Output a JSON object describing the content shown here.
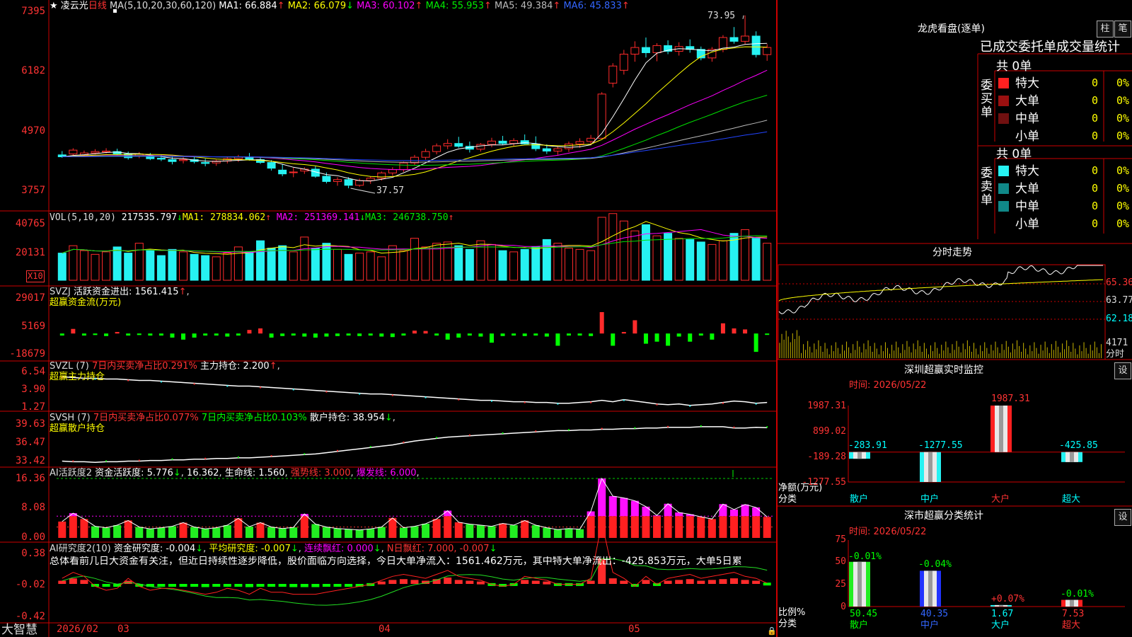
{
  "app": {
    "brand": "大智慧",
    "star": "★",
    "stock_name": "凌云光",
    "period": "日线"
  },
  "colors": {
    "up": "#ff2b2b",
    "down": "#26f2f2",
    "vol_green": "#00ff00",
    "axis": "#cc0000",
    "ma1": "#ffffff",
    "ma2": "#ffff00",
    "ma3": "#ff00ff",
    "ma4": "#00e000",
    "ma5": "#bbbbbb",
    "ma6": "#2244ff"
  },
  "price_panel": {
    "header": {
      "ma_title": "MA(5,10,20,30,60,120)",
      "items": [
        {
          "label": "MA1: 66.884",
          "arrow": "↑"
        },
        {
          "label": "MA2: 66.079",
          "arrow": "↓"
        },
        {
          "label": "MA3: 60.102",
          "arrow": "↑"
        },
        {
          "label": "MA4: 55.953",
          "arrow": "↑"
        },
        {
          "label": "MA5: 49.384",
          "arrow": "↑"
        },
        {
          "label": "MA6: 45.833",
          "arrow": "↑"
        }
      ]
    },
    "y_ticks": [
      "7395",
      "6182",
      "4970",
      "3757"
    ],
    "high_label": "73.95",
    "low_label": "37.57"
  },
  "vol_panel": {
    "title": "VOL(5,10,20)",
    "value": "217535.797",
    "value_arrow": "↓",
    "items": [
      {
        "label": "MA1: 278834.062",
        "arrow": "↑"
      },
      {
        "label": "MA2: 251369.141",
        "arrow": "↓"
      },
      {
        "label": "MA3: 246738.750",
        "arrow": "↑"
      }
    ],
    "y_ticks": [
      "40765",
      "20131"
    ],
    "unit": "X10"
  },
  "svzj_panel": {
    "title": "SVZJ",
    "label": "活跃资金进出: 1561.415",
    "arrow": "↑",
    "subtitle": "超赢资金流(万元)",
    "y_ticks": [
      "29017",
      "5169",
      "-18679"
    ]
  },
  "svzl_panel": {
    "title": "SVZL (7)",
    "net": "7日内买卖净占比0.291%",
    "hold": "主力持仓: 2.200",
    "hold_arrow": "↑",
    "subtitle": "超赢主力持仓",
    "y_ticks": [
      "6.54",
      "3.90",
      "1.27"
    ]
  },
  "svsh_panel": {
    "title": "SVSH (7)",
    "net1": "7日内买卖净占比0.077%",
    "net2": "7日内买卖净占比0.103%",
    "hold": "散户持仓: 38.954",
    "hold_arrow": "↓",
    "subtitle": "超赢散户持仓",
    "y_ticks": [
      "39.63",
      "36.47",
      "33.42"
    ]
  },
  "ai_active_panel": {
    "title": "AI活跃度2",
    "active": "资金活跃度: 5.776",
    "active_arrow": "↓",
    "value2": "16.362",
    "life": "生命线: 1.560",
    "strong": "强势线: 3.000",
    "burst": "爆发线: 6.000",
    "y_ticks": [
      "16.36",
      "8.08",
      "0.00"
    ]
  },
  "ai_research_panel": {
    "title": "AI研究度2(10)",
    "research": "资金研究度: -0.004",
    "research_arrow": "↓",
    "avg": "平均研究度: -0.007",
    "avg_arrow": "↓",
    "consec": "连续飘红: 0.000",
    "consec_arrow": "↓",
    "nday": "N日飘红: 7.000, -0.007",
    "nday_arrow": "↓",
    "summary": "总体看前几日大资金有关注，但近日持续性逐步降低，股价面临方向选择，今日大单净流入：1561.462万元，其中特大单净流出：-425.853万元，大单5日累",
    "y_ticks": [
      "0.38",
      "-0.02",
      "-0.42"
    ]
  },
  "x_axis": {
    "labels": [
      "2026/02",
      "03",
      "04",
      "05"
    ]
  },
  "dragon": {
    "title": "龙虎看盘(逐单)",
    "btn1": "柱",
    "btn2": "笔",
    "header": "已成交委托单成交量统计",
    "buy": {
      "side_label": "委买单",
      "total": "共 0单",
      "rows": [
        {
          "name": "特大",
          "value": "0",
          "pct": "0%"
        },
        {
          "name": "大单",
          "value": "0",
          "pct": "0%"
        },
        {
          "name": "中单",
          "value": "0",
          "pct": "0%"
        },
        {
          "name": "小单",
          "value": "0",
          "pct": "0%"
        }
      ]
    },
    "sell": {
      "side_label": "委卖单",
      "total": "共 0单",
      "rows": [
        {
          "name": "特大",
          "value": "0",
          "pct": "0%"
        },
        {
          "name": "大单",
          "value": "0",
          "pct": "0%"
        },
        {
          "name": "中单",
          "value": "0",
          "pct": "0%"
        },
        {
          "name": "小单",
          "value": "0",
          "pct": "0%"
        }
      ]
    }
  },
  "intraday": {
    "title": "分时走势",
    "y_ticks": [
      "65.36",
      "63.77",
      "62.18"
    ],
    "vol_label": "4171",
    "unit": "分时"
  },
  "sz_monitor": {
    "title": "深圳超赢实时监控",
    "time": "时间: 2026/05/22",
    "setting": "设",
    "y_ticks": [
      "1987.31",
      "899.02",
      "-189.28",
      "-1277.55"
    ],
    "y_unit": "净额(万元)",
    "x_title": "分类",
    "categories": [
      "散户",
      "中户",
      "大户",
      "超大"
    ],
    "value_labels": [
      "-283.91",
      "-1277.55",
      "1987.31",
      "-425.85"
    ]
  },
  "sz_class": {
    "title": "深市超赢分类统计",
    "time": "时间: 2026/05/22",
    "setting": "设",
    "y_ticks": [
      "75",
      "50",
      "25",
      "0"
    ],
    "y_unit": "比例%",
    "x_title": "分类",
    "categories": [
      "散户",
      "中户",
      "大户",
      "超大"
    ],
    "top_labels": [
      "-0.01%",
      "-0.04%",
      "+0.07%",
      "-0.01%"
    ],
    "bottom_labels": [
      "50.45",
      "40.35",
      "1.67",
      "7.53"
    ]
  },
  "chart_data": [
    {
      "type": "candlestick",
      "title": "凌云光 日线",
      "ylim": [
        34,
        76
      ],
      "annotations": [
        {
          "label": "73.95",
          "kind": "high"
        },
        {
          "label": "37.57",
          "kind": "low"
        }
      ],
      "ohlc": [
        [
          44.6,
          45.4,
          44.0,
          44.2
        ],
        [
          44.8,
          46.0,
          44.4,
          45.6
        ],
        [
          44.6,
          45.5,
          44.3,
          45.0
        ],
        [
          45.0,
          45.8,
          44.7,
          45.3
        ],
        [
          45.2,
          46.0,
          44.9,
          45.4
        ],
        [
          45.3,
          45.9,
          44.6,
          44.8
        ],
        [
          44.8,
          45.3,
          43.6,
          44.0
        ],
        [
          44.4,
          45.2,
          43.9,
          44.8
        ],
        [
          44.3,
          45.0,
          43.5,
          43.8
        ],
        [
          43.9,
          44.6,
          43.3,
          43.7
        ],
        [
          43.6,
          44.3,
          42.6,
          43.2
        ],
        [
          43.4,
          44.1,
          42.8,
          43.6
        ],
        [
          43.6,
          44.2,
          42.8,
          43.2
        ],
        [
          43.0,
          43.8,
          42.2,
          42.8
        ],
        [
          42.9,
          43.6,
          42.3,
          43.3
        ],
        [
          43.3,
          44.1,
          42.8,
          43.8
        ],
        [
          43.8,
          44.6,
          43.1,
          44.2
        ],
        [
          44.2,
          45.0,
          43.4,
          43.6
        ],
        [
          43.6,
          44.1,
          42.7,
          43.0
        ],
        [
          43.0,
          43.5,
          41.3,
          41.8
        ],
        [
          41.4,
          42.6,
          40.1,
          40.6
        ],
        [
          40.9,
          41.9,
          39.9,
          41.0
        ],
        [
          41.2,
          42.0,
          40.6,
          41.6
        ],
        [
          41.6,
          42.2,
          39.8,
          40.1
        ],
        [
          40.1,
          40.9,
          38.6,
          39.0
        ],
        [
          39.0,
          39.9,
          38.1,
          39.4
        ],
        [
          39.4,
          39.9,
          37.57,
          38.2
        ],
        [
          38.2,
          39.6,
          37.9,
          39.2
        ],
        [
          39.2,
          40.1,
          38.5,
          39.7
        ],
        [
          39.7,
          41.1,
          39.2,
          40.8
        ],
        [
          40.8,
          42.0,
          40.2,
          41.5
        ],
        [
          41.5,
          43.2,
          41.0,
          42.9
        ],
        [
          42.9,
          44.6,
          42.4,
          44.1
        ],
        [
          44.1,
          45.9,
          43.6,
          45.3
        ],
        [
          45.3,
          47.0,
          44.7,
          46.5
        ],
        [
          46.5,
          47.9,
          45.8,
          47.0
        ],
        [
          47.0,
          48.4,
          46.1,
          46.4
        ],
        [
          46.4,
          47.4,
          45.1,
          45.8
        ],
        [
          45.8,
          47.1,
          45.3,
          46.8
        ],
        [
          46.8,
          48.2,
          46.2,
          47.5
        ],
        [
          47.5,
          48.6,
          46.7,
          47.0
        ],
        [
          47.0,
          48.1,
          46.4,
          47.6
        ],
        [
          47.6,
          48.9,
          46.8,
          46.9
        ],
        [
          46.9,
          48.5,
          45.4,
          45.9
        ],
        [
          45.9,
          46.8,
          44.8,
          45.4
        ],
        [
          45.4,
          46.3,
          44.6,
          45.9
        ],
        [
          45.9,
          47.4,
          45.2,
          46.9
        ],
        [
          46.9,
          48.1,
          46.1,
          47.4
        ],
        [
          47.4,
          48.8,
          46.6,
          48.1
        ],
        [
          48.1,
          57.8,
          48.0,
          57.4
        ],
        [
          59.7,
          63.9,
          58.8,
          63.3
        ],
        [
          62.4,
          66.7,
          61.5,
          65.8
        ],
        [
          65.8,
          68.5,
          64.2,
          67.2
        ],
        [
          67.2,
          69.3,
          65.1,
          66.1
        ],
        [
          66.1,
          68.1,
          64.3,
          67.6
        ],
        [
          67.6,
          68.7,
          65.8,
          66.4
        ],
        [
          66.4,
          68.3,
          65.5,
          67.4
        ],
        [
          67.4,
          68.9,
          66.1,
          66.8
        ],
        [
          66.8,
          67.4,
          64.5,
          65.0
        ],
        [
          65.0,
          67.3,
          64.2,
          66.8
        ],
        [
          66.8,
          69.8,
          66.2,
          69.3
        ],
        [
          69.3,
          71.5,
          68.0,
          68.5
        ],
        [
          68.5,
          73.95,
          67.9,
          69.6
        ],
        [
          69.6,
          70.6,
          65.1,
          65.7
        ],
        [
          65.7,
          67.9,
          64.4,
          67.2
        ]
      ]
    },
    {
      "type": "bar",
      "title": "VOL(5,10,20)",
      "unit": "X10",
      "values": [
        22000,
        28000,
        24000,
        21000,
        23000,
        27000,
        22000,
        30000,
        24000,
        20000,
        25000,
        23000,
        21000,
        20000,
        19000,
        22000,
        27000,
        23000,
        32000,
        26000,
        28000,
        23000,
        35000,
        26000,
        30000,
        25000,
        21000,
        22000,
        23000,
        19000,
        28000,
        24000,
        34000,
        27000,
        30000,
        31000,
        28000,
        25000,
        32000,
        29000,
        24000,
        23000,
        25000,
        27000,
        33000,
        30000,
        26000,
        25000,
        24000,
        51000,
        54000,
        48000,
        40000,
        45000,
        36000,
        38000,
        34000,
        33000,
        31000,
        29000,
        32000,
        38000,
        41000,
        34000,
        30000
      ]
    },
    {
      "type": "bar",
      "title": "SVZJ 活跃资金进出",
      "unit": "万元",
      "values": [
        -2000,
        4500,
        -2000,
        -1500,
        -2500,
        1500,
        -2000,
        -1500,
        -2000,
        -2000,
        -4000,
        -6000,
        -4000,
        -2000,
        -2000,
        -3000,
        -2000,
        3500,
        5000,
        -4000,
        -2500,
        -2000,
        -3000,
        -4000,
        -3000,
        -2500,
        -2000,
        -2500,
        -2000,
        -3000,
        -3500,
        -2000,
        2800,
        2500,
        -2000,
        -6000,
        -4000,
        -2000,
        -3000,
        -9000,
        -2500,
        -2000,
        -2500,
        -2000,
        -3000,
        -12000,
        -2000,
        -2000,
        -2500,
        21000,
        -12000,
        1500,
        13000,
        -10000,
        -8000,
        -12000,
        -3000,
        -8000,
        -2000,
        -6000,
        10000,
        5000,
        4000,
        -18000,
        -1000
      ]
    },
    {
      "type": "line",
      "title": "SVZL 主力持仓",
      "values": [
        5.8,
        5.7,
        5.6,
        5.6,
        5.5,
        5.5,
        5.4,
        5.3,
        5.3,
        5.2,
        5.1,
        5.0,
        4.9,
        4.8,
        4.7,
        4.6,
        4.5,
        4.5,
        4.4,
        4.3,
        4.2,
        4.1,
        4.0,
        3.9,
        3.8,
        3.7,
        3.6,
        3.5,
        3.4,
        3.4,
        3.3,
        3.2,
        3.1,
        3.0,
        2.9,
        2.8,
        2.7,
        2.6,
        2.5,
        2.5,
        2.4,
        2.3,
        2.3,
        2.2,
        2.2,
        2.1,
        2.1,
        2.2,
        2.3,
        2.5,
        2.3,
        2.6,
        2.4,
        2.2,
        2.0,
        1.9,
        2.0,
        1.8,
        1.9,
        2.0,
        2.2,
        2.4,
        2.3,
        2.1,
        2.2
      ]
    },
    {
      "type": "line",
      "title": "SVSH 散户持仓",
      "values": [
        33.8,
        33.7,
        33.7,
        33.6,
        33.7,
        33.7,
        33.8,
        33.8,
        33.9,
        33.9,
        34.0,
        34.0,
        34.1,
        34.1,
        34.2,
        34.2,
        34.3,
        34.3,
        34.4,
        34.5,
        34.6,
        34.7,
        34.8,
        34.9,
        35.1,
        35.3,
        35.5,
        35.7,
        35.9,
        36.1,
        36.3,
        36.6,
        36.9,
        37.1,
        37.3,
        37.5,
        37.6,
        37.7,
        37.8,
        37.9,
        38.0,
        38.1,
        38.2,
        38.3,
        38.4,
        38.5,
        38.5,
        38.6,
        38.6,
        38.7,
        38.7,
        38.8,
        38.8,
        38.9,
        38.9,
        39.0,
        39.0,
        39.0,
        39.1,
        39.1,
        39.1,
        38.9,
        38.9,
        39.0,
        38.95
      ]
    },
    {
      "type": "bar",
      "title": "AI活跃度2 资金活跃度",
      "values": [
        4.5,
        6.8,
        5.2,
        3.2,
        2.8,
        3.5,
        4.8,
        3.0,
        2.5,
        2.8,
        3.2,
        4.2,
        3.0,
        2.5,
        2.8,
        3.5,
        5.4,
        3.1,
        4.2,
        3.0,
        2.6,
        2.9,
        6.6,
        3.8,
        3.0,
        2.6,
        2.4,
        2.2,
        2.5,
        3.0,
        5.5,
        2.8,
        3.2,
        3.9,
        5.2,
        7.5,
        4.3,
        3.8,
        3.5,
        3.2,
        4.0,
        3.5,
        4.8,
        3.5,
        2.8,
        2.3,
        2.6,
        2.4,
        7.3,
        16.36,
        11.5,
        11.0,
        10.2,
        8.6,
        6.2,
        9.4,
        7.0,
        6.5,
        5.8,
        5.2,
        9.3,
        7.8,
        9.2,
        8.4,
        5.78
      ]
    },
    {
      "type": "bar",
      "title": "AI研究度2(10) 资金研究度",
      "values": [
        0.02,
        0.05,
        0.03,
        -0.02,
        -0.04,
        -0.03,
        0.02,
        -0.02,
        -0.04,
        -0.03,
        -0.03,
        -0.04,
        -0.05,
        -0.06,
        -0.05,
        -0.03,
        -0.04,
        -0.06,
        -0.03,
        -0.05,
        -0.05,
        -0.06,
        -0.06,
        -0.06,
        -0.05,
        -0.04,
        -0.03,
        -0.02,
        -0.01,
        0.01,
        0.03,
        0.04,
        0.03,
        0.02,
        0.04,
        0.06,
        0.03,
        0.02,
        0.01,
        -0.01,
        -0.02,
        -0.01,
        0.03,
        0.02,
        0.01,
        -0.01,
        -0.01,
        -0.01,
        0.02,
        0.3,
        0.05,
        0.02,
        -0.02,
        0.03,
        -0.01,
        0.02,
        0.03,
        0.04,
        0.02,
        0.03,
        0.04,
        0.05,
        0.03,
        0.02,
        -0.004
      ]
    },
    {
      "type": "bar",
      "title": "深圳超赢实时监控",
      "categories": [
        "散户",
        "中户",
        "大户",
        "超大"
      ],
      "values": [
        -283.91,
        -1277.55,
        1987.31,
        -425.85
      ],
      "ylim": [
        -1277.55,
        1987.31
      ],
      "ylabel": "净额(万元)"
    },
    {
      "type": "bar",
      "title": "深市超赢分类统计",
      "categories": [
        "散户",
        "中户",
        "大户",
        "超大"
      ],
      "values": [
        50.45,
        40.35,
        1.67,
        7.53
      ],
      "ylim": [
        0,
        75
      ],
      "ylabel": "比例%"
    }
  ]
}
